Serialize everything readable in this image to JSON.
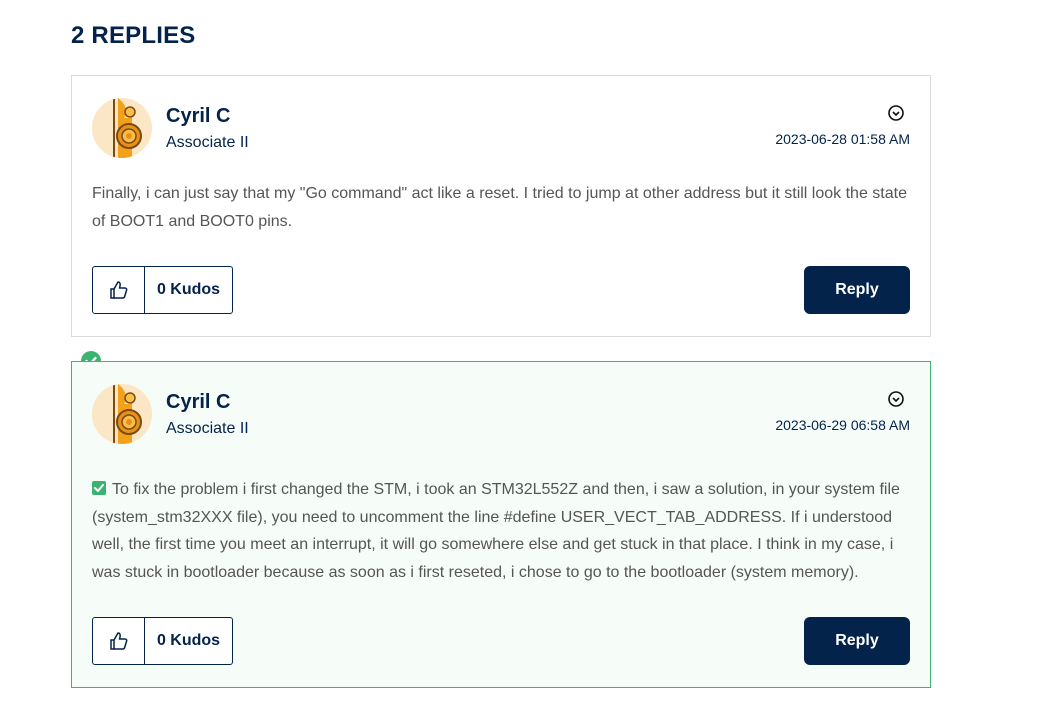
{
  "replies_heading": "2 REPLIES",
  "colors": {
    "brand": "#03234b",
    "solution_accent": "#3cb371",
    "solution_bg": "#f6fcf8"
  },
  "replies": [
    {
      "author": "Cyril C",
      "rank": "Associate II",
      "timestamp": "2023-06-28 01:58 AM",
      "body": "Finally, i can just say that my \"Go command\" act like a reset. I tried to jump at other address but it still look the state of BOOT1 and BOOT0 pins.",
      "kudos_label": "0 Kudos",
      "reply_label": "Reply",
      "is_solution": false
    },
    {
      "author": "Cyril C",
      "rank": "Associate II",
      "timestamp": "2023-06-29 06:58 AM",
      "body": "To fix the problem i first changed the STM, i took an STM32L552Z and then, i saw a solution, in your system file (system_stm32XXX file), you need to uncomment the line #define USER_VECT_TAB_ADDRESS. If i understood well, the first time you meet an interrupt, it will go somewhere else and get stuck in that place. I think in my case, i was stuck in bootloader because as soon as i first reseted, i chose to go to the bootloader (system memory).",
      "kudos_label": "0 Kudos",
      "reply_label": "Reply",
      "is_solution": true
    }
  ],
  "icons": {
    "avatar": "avatar-image",
    "menu": "chevron-down-circle-icon",
    "thumb": "thumbs-up-icon",
    "solution": "check-circle-icon",
    "inline_check": "checkbox-check-icon"
  }
}
